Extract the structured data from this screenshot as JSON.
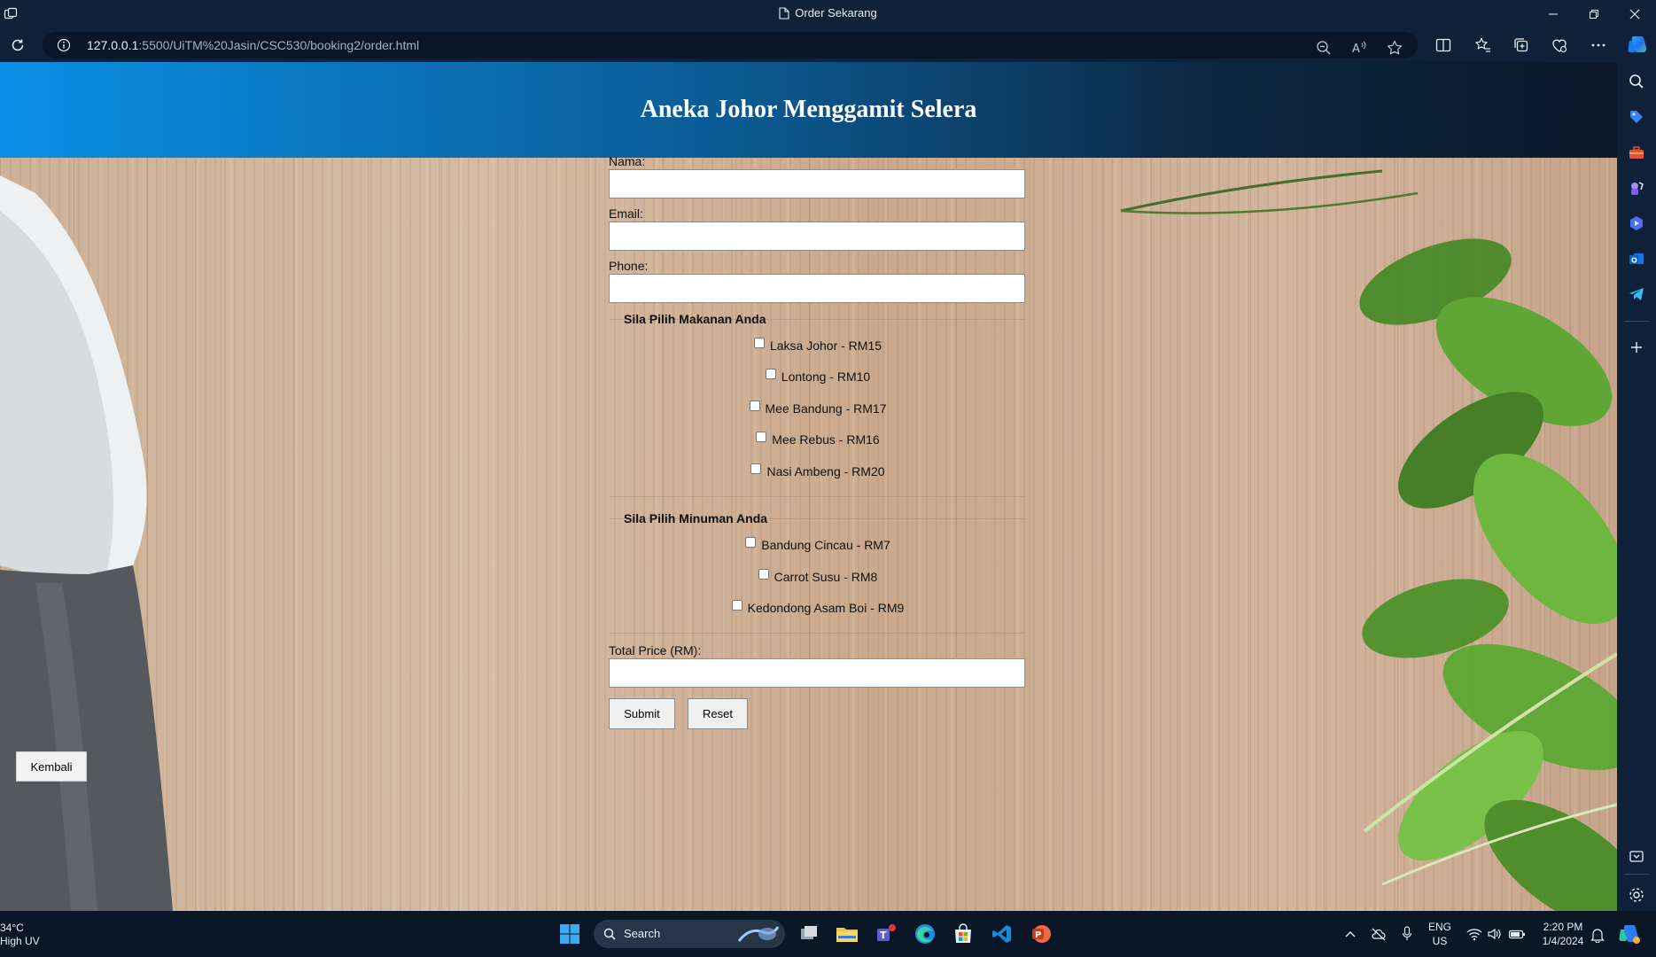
{
  "browser": {
    "tab_title": "Order Sekarang",
    "url_host": "127.0.0.1",
    "url_path": ":5500/UiTM%20Jasin/CSC530/booking2/order.html",
    "icons": [
      "app-icon",
      "document-icon",
      "refresh-icon",
      "info-icon",
      "zoom-out-icon",
      "read-aloud-icon",
      "favorite-star-icon",
      "split-screen-icon",
      "favorites-icon",
      "collections-icon",
      "browser-essentials-icon",
      "more-icon",
      "copilot-icon"
    ],
    "window_buttons": [
      "minimize-icon",
      "restore-icon",
      "close-icon"
    ]
  },
  "page": {
    "title": "Aneka Johor Menggamit Selera",
    "form": {
      "name_label": "Nama:",
      "email_label": "Email:",
      "phone_label": "Phone:",
      "food_section": "Sila Pilih Makanan Anda",
      "foods": [
        "Laksa Johor - RM15",
        "Lontong - RM10",
        "Mee Bandung - RM17",
        "Mee Rebus - RM16",
        "Nasi Ambeng - RM20"
      ],
      "drink_section": "Sila Pilih Minuman Anda",
      "drinks": [
        "Bandung Cincau - RM7",
        "Carrot Susu - RM8",
        "Kedondong Asam Boi - RM9"
      ],
      "total_label": "Total Price (RM):",
      "submit_label": "Submit",
      "reset_label": "Reset"
    },
    "back_button": "Kembali"
  },
  "sidebar_icons": [
    "search-icon",
    "shopping-tag-icon",
    "toolbox-icon",
    "games-icon",
    "copilot-designer-icon",
    "outlook-icon",
    "telegram-icon",
    "add-icon",
    "screenshot-icon",
    "settings-icon"
  ],
  "taskbar": {
    "temperature": "34°C",
    "weather": "High UV",
    "search_placeholder": "Search",
    "apps": [
      "windows-start-icon",
      "task-view-icon",
      "file-explorer-icon",
      "teams-icon",
      "edge-icon",
      "microsoft-store-icon",
      "vscode-icon",
      "powerpoint-icon"
    ],
    "language": "ENG",
    "region": "US",
    "time": "2:20 PM",
    "date": "1/4/2024"
  }
}
